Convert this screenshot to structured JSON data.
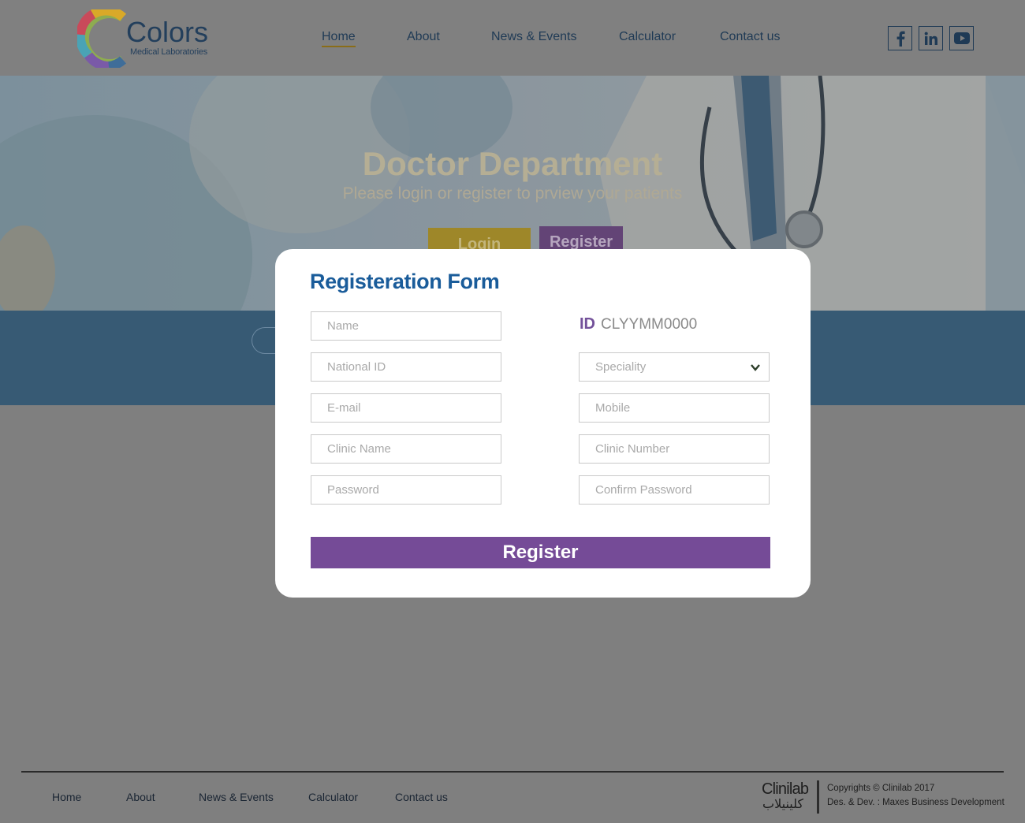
{
  "brand": {
    "name": "Colors",
    "tagline": "Medical Laboratories"
  },
  "nav": {
    "items": [
      "Home",
      "About",
      "News & Events",
      "Calculator",
      "Contact us"
    ],
    "active": "Home"
  },
  "social": [
    "facebook-icon",
    "linkedin-icon",
    "youtube-icon"
  ],
  "hero": {
    "title": "Doctor Department",
    "subtitle": "Please login or register to prview your patients",
    "login_label": "Login",
    "register_label": "Register"
  },
  "modal": {
    "title": "Registeration Form",
    "id_label": "ID",
    "id_value": "CLYYMM0000",
    "fields": {
      "name": "Name",
      "national_id": "National ID",
      "email": "E-mail",
      "clinic_name": "Clinic Name",
      "password": "Password",
      "speciality": "Speciality",
      "mobile": "Mobile",
      "clinic_number": "Clinic Number",
      "confirm_password": "Confirm Password"
    },
    "submit_label": "Register"
  },
  "footer": {
    "links": [
      "Home",
      "About",
      "News & Events",
      "Calculator",
      "Contact us"
    ],
    "logo_en": "Clinilab",
    "logo_ar": "كلينيلاب",
    "copyright": "Copyrights © Clinilab 2017",
    "credits": "Des. & Dev. : Maxes Business Development"
  },
  "colors": {
    "primary_blue": "#1a5c9a",
    "purple": "#754b97",
    "gold": "#d9a928",
    "band": "#375a74"
  }
}
